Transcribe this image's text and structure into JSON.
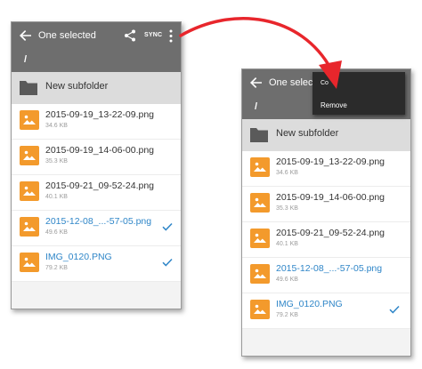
{
  "colors": {
    "toolbar": "#6e6e6e",
    "accent": "#2f86c8",
    "file_icon": "#f39a2c",
    "arrow": "#e8262c",
    "menu": "#2b2b2b"
  },
  "left": {
    "toolbar": {
      "title": "One selected",
      "sync_label": "SYNC"
    },
    "path": "/",
    "folder": {
      "label": "New subfolder",
      "icon": "folder-icon"
    },
    "files": [
      {
        "name": "2015-09-19_13-22-09.png",
        "size": "34.6 KB",
        "selected": false
      },
      {
        "name": "2015-09-19_14-06-00.png",
        "size": "35.3 KB",
        "selected": false
      },
      {
        "name": "2015-09-21_09-52-24.png",
        "size": "40.1 KB",
        "selected": false
      },
      {
        "name": "2015-12-08_...-57-05.png",
        "size": "49.6 KB",
        "selected": true
      },
      {
        "name": "IMG_0120.PNG",
        "size": "79.2 KB",
        "selected": true
      }
    ]
  },
  "right": {
    "toolbar": {
      "title": "One selecte"
    },
    "path": "/",
    "folder": {
      "label": "New subfolder",
      "icon": "folder-icon"
    },
    "menu": {
      "copy_label": "Co",
      "remove_label": "Remove"
    },
    "files": [
      {
        "name": "2015-09-19_13-22-09.png",
        "size": "34.6 KB",
        "selected": false
      },
      {
        "name": "2015-09-19_14-06-00.png",
        "size": "35.3 KB",
        "selected": false
      },
      {
        "name": "2015-09-21_09-52-24.png",
        "size": "40.1 KB",
        "selected": false
      },
      {
        "name": "2015-12-08_...-57-05.png",
        "size": "49.6 KB",
        "selected": true
      },
      {
        "name": "IMG_0120.PNG",
        "size": "79.2 KB",
        "selected": true
      }
    ]
  }
}
